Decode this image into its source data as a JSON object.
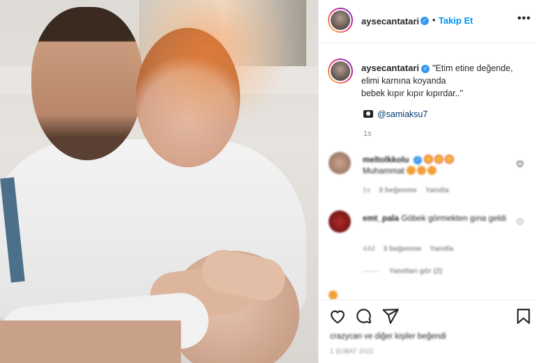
{
  "post": {
    "username": "aysecantatari",
    "follow_label": "Takip Et",
    "dot": "•",
    "more_label": "•••"
  },
  "caption": {
    "username": "aysecantatari",
    "text_line1": "\"Etim etine değende,",
    "text_line2": "elimi karnına koyanda",
    "text_line3": "bebek kıpır kıpır kıpırdar..\"",
    "credit": "@samiaksu7",
    "time": "1s"
  },
  "comments": [
    {
      "username": "meltolkkolu",
      "text": "Muhammat",
      "time": "1s",
      "likes": "3 beğenme",
      "reply": "Yanıtla"
    },
    {
      "username": "emt_pala",
      "text": "Göbek görmekten gına geldi",
      "time": "44d",
      "likes": "3 beğenme",
      "reply": "Yanıtla"
    }
  ],
  "view_replies": "Yanıtları gör (2)",
  "likes_text": "crazycan ve diğer kişiler beğendi",
  "date_text": "1 ŞUBAT 2022",
  "colors": {
    "accent": "#0095f6",
    "verified": "#3897f0",
    "text": "#262626",
    "muted": "#8e8e8e"
  }
}
